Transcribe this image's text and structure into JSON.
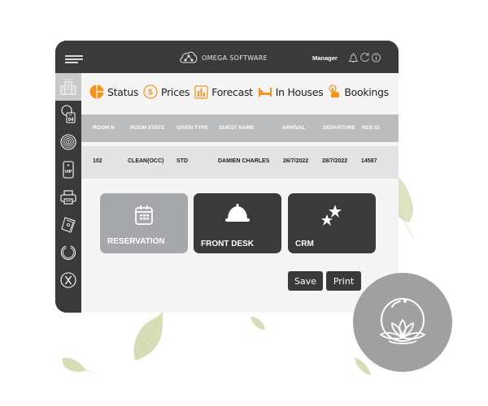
{
  "header": {
    "brand": "OMEGA SOFTWARE",
    "user_role": "Manager",
    "icons": [
      "menu-icon",
      "cloud-network-icon",
      "bell-icon",
      "refresh-icon",
      "info-icon"
    ]
  },
  "sidebar": {
    "items": [
      {
        "name": "building",
        "icon": "building-icon",
        "active": true
      },
      {
        "name": "calendar-day",
        "icon": "calendar-day-icon",
        "label": "04"
      },
      {
        "name": "fingerprint",
        "icon": "fingerprint-icon"
      },
      {
        "name": "vip",
        "icon": "vip-card-icon",
        "label": "VIP"
      },
      {
        "name": "printer",
        "icon": "printer-icon"
      },
      {
        "name": "cash",
        "icon": "cash-icon"
      },
      {
        "name": "refresh",
        "icon": "circle-refresh-icon"
      },
      {
        "name": "close",
        "icon": "close-circle-icon",
        "label": "X"
      }
    ]
  },
  "tabs": [
    {
      "label": "Status",
      "icon": "pie-chart-icon"
    },
    {
      "label": "Prices",
      "icon": "dollar-icon"
    },
    {
      "label": "Forecast",
      "icon": "bar-chart-icon"
    },
    {
      "label": "In Houses",
      "icon": "bed-icon"
    },
    {
      "label": "Bookings",
      "icon": "hand-pointer-icon"
    }
  ],
  "table": {
    "columns": [
      "ROOM N",
      "ROOM STATE",
      "GIVEN TYPE",
      "GUEST NAME",
      "ARRIVAL",
      "DEPARTURE",
      "RES ID"
    ],
    "rows": [
      [
        "102",
        "CLEAN(OCC)",
        "STD",
        "DAMIEN CHARLES",
        "26/7/2022",
        "28/7/2022",
        "14587"
      ]
    ]
  },
  "tiles": [
    {
      "label": "RESERVATION",
      "icon": "calendar-icon"
    },
    {
      "label": "FRONT DESK",
      "icon": "service-bell-icon"
    },
    {
      "label": "CRM",
      "icon": "stars-icon"
    }
  ],
  "buttons": {
    "save": "Save",
    "print": "Print"
  },
  "colors": {
    "accent": "#f7941d",
    "dark": "#3a3a3a",
    "header_gray": "#bbbcbe",
    "tile_light": "#a6a7ab"
  }
}
